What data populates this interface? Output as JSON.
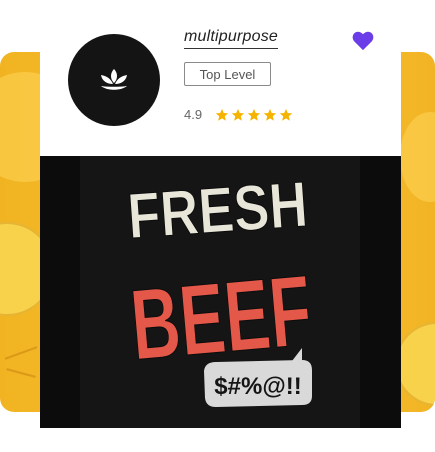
{
  "card": {
    "title": "multipurpose",
    "badge": "Top Level",
    "rating": "4.9",
    "stars": 5
  },
  "artwork": {
    "line1": "FRESH",
    "line2": "BEEF",
    "bubble": "$#%@!!"
  },
  "icons": {
    "logo": "lotus-icon",
    "favorite": "heart-icon",
    "rating": "star-icon"
  },
  "colors": {
    "accent": "#6a3de8",
    "star": "#f5b400",
    "background_panel": "#f3b828"
  }
}
